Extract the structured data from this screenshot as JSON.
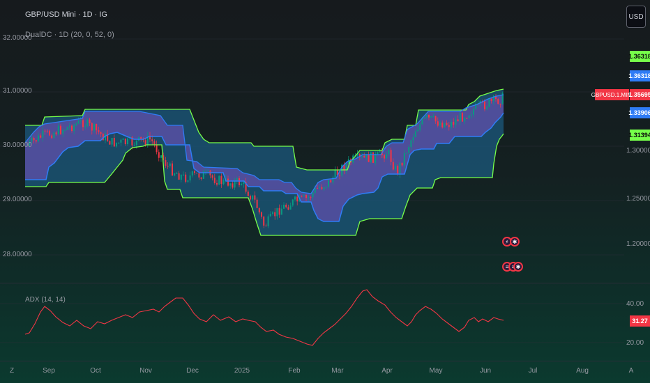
{
  "header": {
    "symbol": "GBP/USD Mini · 1D · IG",
    "indicator": "DualDC · 1D (20, 0, 52, 0)"
  },
  "currency_button": "USD",
  "left_axis": [
    "32.00000",
    "31.00000",
    "30.00000",
    "29.00000",
    "28.00000"
  ],
  "right_axis": [
    "1.30000",
    "1.25000",
    "1.20000"
  ],
  "price_badges": {
    "upper_outer": "1.36318",
    "upper_inner": "1.36318",
    "symbol": "GBPUSD.1.MINI",
    "last": "1.35695",
    "lower_inner": "1.33906",
    "lower_outer": "1.31394"
  },
  "adx": {
    "label": "ADX (14, 14)",
    "axis": [
      "40.00",
      "20.00"
    ],
    "value": "31.27"
  },
  "time_axis": [
    "Z",
    "Sep",
    "Oct",
    "Nov",
    "Dec",
    "2025",
    "Feb",
    "Mar",
    "Apr",
    "May",
    "Jun",
    "Jul",
    "Aug",
    "A"
  ],
  "colors": {
    "outer_channel": "#76ff4a",
    "inner_channel": "#2f7cf6",
    "inner_fill": "#5b4fa8",
    "outer_fill": "#1b5a7e",
    "candle_up": "#089981",
    "candle_down": "#f23645",
    "adx_line": "#f23645"
  },
  "chart_data": {
    "type": "line",
    "title": "GBP/USD Mini · 1D · IG",
    "indicator": "DualDC · 1D (20, 0, 52, 0)",
    "last_price": 1.35695,
    "outer_upper": 1.36318,
    "inner_lower": 1.33906,
    "outer_lower": 1.31394,
    "y_ticks": [
      1.2,
      1.25,
      1.3
    ],
    "adx_value": 31.27,
    "adx_ticks": [
      20,
      40
    ]
  }
}
